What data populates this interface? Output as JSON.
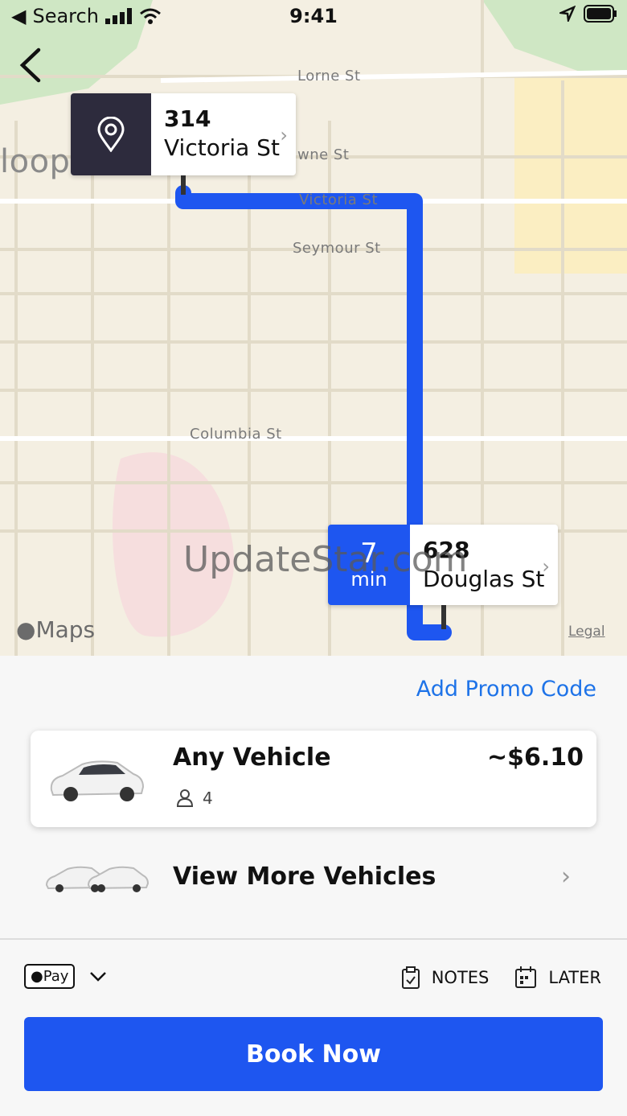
{
  "status_bar": {
    "back_app": "Search",
    "time": "9:41"
  },
  "map": {
    "streets": [
      "Lorne St",
      "wne St",
      "Victoria St",
      "Seymour St",
      "Columbia St"
    ],
    "partial_label": "loop",
    "pickup": {
      "number": "314",
      "street": "Victoria St"
    },
    "destination": {
      "number": "628",
      "street": "Douglas St",
      "eta_value": "7",
      "eta_unit": "min"
    },
    "watermark": "UpdateStar.com",
    "maps_label": "Maps",
    "legal": "Legal",
    "route_color": "#1e56f0"
  },
  "sheet": {
    "promo_label": "Add Promo Code",
    "vehicle": {
      "name": "Any Vehicle",
      "price": "~$6.10",
      "passengers": "4"
    },
    "view_more_label": "View More Vehicles",
    "payment_label": "Pay",
    "notes_label": "NOTES",
    "later_label": "LATER",
    "book_label": "Book Now"
  },
  "colors": {
    "accent": "#1e56f0",
    "link": "#1e73e8",
    "pin_bg": "#2d2b3d"
  }
}
